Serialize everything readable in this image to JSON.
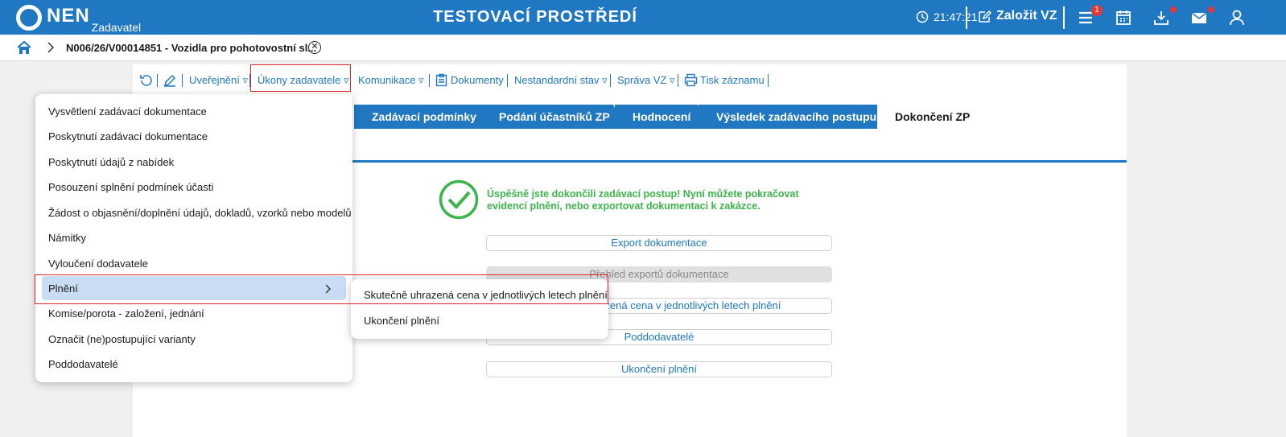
{
  "header": {
    "logo_text": "NEN",
    "logo_sub": "Zadavatel",
    "env_title": "TESTOVACÍ PROSTŘEDÍ",
    "time": "21:47:21",
    "create_label": "Založit VZ",
    "menu_badge": "1"
  },
  "breadcrumb": {
    "title": "N006/26/V00014851 - Vozidla pro pohotovostní sl..."
  },
  "toolbar": {
    "publish": "Uveřejnění ▿",
    "actions": "Úkony zadavatele ▿",
    "communication": "Komunikace ▿",
    "documents": "Dokumenty",
    "nonstandard": "Nestandardní stav ▿",
    "management": "Správa VZ ▿",
    "print": "Tisk záznamu"
  },
  "tabs": [
    {
      "label": "Zadávací podmínky"
    },
    {
      "label": "Podání účastníků ZP"
    },
    {
      "label": "Hodnocení"
    },
    {
      "label": "Výsledek zadávacího postupu"
    },
    {
      "label": "Dokončení ZP"
    }
  ],
  "main": {
    "success_message": "Úspěšně jste dokončili zadávací postup! Nyní můžete pokračovat evidencí plnění, nebo exportovat dokumentaci k zakázce.",
    "buttons": [
      {
        "label": "Export dokumentace"
      },
      {
        "label": "Přehled exportů dokumentace"
      },
      {
        "label": "Skutečně uhrazená cena v jednotlivých letech plnění"
      },
      {
        "label": "Poddodavatelé"
      },
      {
        "label": "Ukončení plnění"
      }
    ]
  },
  "menu": {
    "items": [
      {
        "label": "Vysvětlení zadávací dokumentace"
      },
      {
        "label": "Poskytnutí zadávací dokumentace"
      },
      {
        "label": "Poskytnutí údajů z nabídek"
      },
      {
        "label": "Posouzení splnění podmínek účasti"
      },
      {
        "label": "Žádost o objasnění/doplnění údajů, dokladů, vzorků nebo modelů"
      },
      {
        "label": "Námitky"
      },
      {
        "label": "Vyloučení dodavatele"
      },
      {
        "label": "Plnění"
      },
      {
        "label": "Komise/porota - založení, jednání"
      },
      {
        "label": "Označit (ne)postupující varianty"
      },
      {
        "label": "Poddodavatelé"
      }
    ],
    "submenu": [
      {
        "label": "Skutečně uhrazená cena v jednotlivých letech plnění"
      },
      {
        "label": "Ukončení plnění"
      }
    ]
  },
  "colors": {
    "brand": "#1f78c1",
    "success": "#3cb44b",
    "highlight": "#e0252b"
  }
}
